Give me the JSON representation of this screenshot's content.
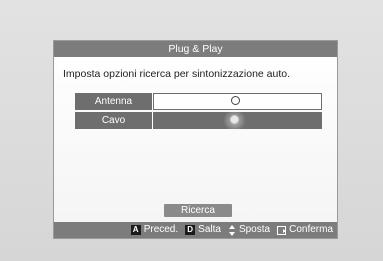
{
  "dialog": {
    "title": "Plug & Play",
    "instruction": "Imposta opzioni ricerca per sintonizzazione auto."
  },
  "options": [
    {
      "label": "Antenna",
      "selected": true
    },
    {
      "label": "Cavo",
      "selected": false
    }
  ],
  "search_button": "Ricerca",
  "footer": {
    "prev_key": "A",
    "prev_label": "Preced.",
    "skip_key": "D",
    "skip_label": "Salta",
    "move_label": "Sposta",
    "confirm_label": "Conferma"
  },
  "icons": [
    "up-down-arrows-icon",
    "enter-icon"
  ],
  "colors": {
    "title_bar": "#7c7c7c",
    "option_label_bg": "#6e6e6e",
    "dialog_bg": "#ffffff",
    "background": "#dcdcdc"
  }
}
